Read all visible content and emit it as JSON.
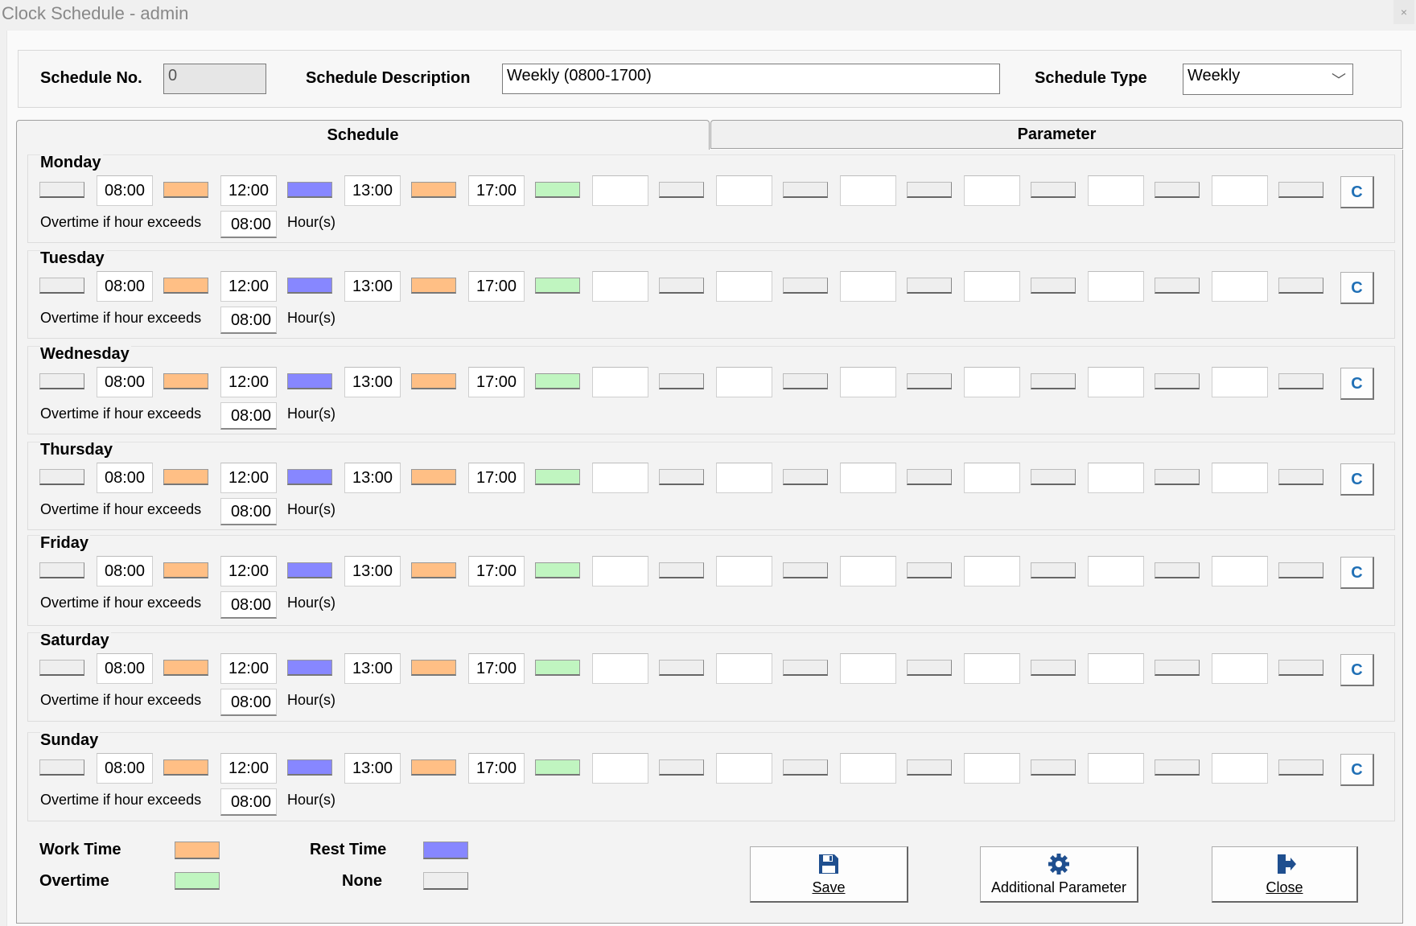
{
  "window": {
    "title": "Clock Schedule - admin",
    "close_glyph": "×"
  },
  "header": {
    "schedule_no_label": "Schedule No.",
    "schedule_no_value": "0",
    "description_label": "Schedule Description",
    "description_value": "Weekly (0800-1700)",
    "type_label": "Schedule Type",
    "type_value": "Weekly"
  },
  "tabs": [
    {
      "label": "Schedule"
    },
    {
      "label": "Parameter"
    }
  ],
  "colors": {
    "work": "#ffbf85",
    "rest": "#8787ff",
    "overtime": "#c0f5c0",
    "none": "#eeeeee",
    "accent": "#1f6fb5"
  },
  "days": [
    {
      "name": "Monday",
      "times": [
        "08:00",
        "12:00",
        "13:00",
        "17:00",
        "",
        "",
        "",
        "",
        "",
        ""
      ],
      "segments": [
        "none",
        "work",
        "rest",
        "work",
        "ot",
        "none",
        "none",
        "none",
        "none",
        "none",
        "none"
      ],
      "ot_label": "Overtime if hour exceeds",
      "ot_value": "08:00",
      "ot_unit": "Hour(s)",
      "clear_label": "C"
    },
    {
      "name": "Tuesday",
      "times": [
        "08:00",
        "12:00",
        "13:00",
        "17:00",
        "",
        "",
        "",
        "",
        "",
        ""
      ],
      "segments": [
        "none",
        "work",
        "rest",
        "work",
        "ot",
        "none",
        "none",
        "none",
        "none",
        "none",
        "none"
      ],
      "ot_label": "Overtime if hour exceeds",
      "ot_value": "08:00",
      "ot_unit": "Hour(s)",
      "clear_label": "C"
    },
    {
      "name": "Wednesday",
      "times": [
        "08:00",
        "12:00",
        "13:00",
        "17:00",
        "",
        "",
        "",
        "",
        "",
        ""
      ],
      "segments": [
        "none",
        "work",
        "rest",
        "work",
        "ot",
        "none",
        "none",
        "none",
        "none",
        "none",
        "none"
      ],
      "ot_label": "Overtime if hour exceeds",
      "ot_value": "08:00",
      "ot_unit": "Hour(s)",
      "clear_label": "C"
    },
    {
      "name": "Thursday",
      "times": [
        "08:00",
        "12:00",
        "13:00",
        "17:00",
        "",
        "",
        "",
        "",
        "",
        ""
      ],
      "segments": [
        "none",
        "work",
        "rest",
        "work",
        "ot",
        "none",
        "none",
        "none",
        "none",
        "none",
        "none"
      ],
      "ot_label": "Overtime if hour exceeds",
      "ot_value": "08:00",
      "ot_unit": "Hour(s)",
      "clear_label": "C"
    },
    {
      "name": "Friday",
      "times": [
        "08:00",
        "12:00",
        "13:00",
        "17:00",
        "",
        "",
        "",
        "",
        "",
        ""
      ],
      "segments": [
        "none",
        "work",
        "rest",
        "work",
        "ot",
        "none",
        "none",
        "none",
        "none",
        "none",
        "none"
      ],
      "ot_label": "Overtime if hour exceeds",
      "ot_value": "08:00",
      "ot_unit": "Hour(s)",
      "clear_label": "C"
    },
    {
      "name": "Saturday",
      "times": [
        "08:00",
        "12:00",
        "13:00",
        "17:00",
        "",
        "",
        "",
        "",
        "",
        ""
      ],
      "segments": [
        "none",
        "work",
        "rest",
        "work",
        "ot",
        "none",
        "none",
        "none",
        "none",
        "none",
        "none"
      ],
      "ot_label": "Overtime if hour exceeds",
      "ot_value": "08:00",
      "ot_unit": "Hour(s)",
      "clear_label": "C"
    },
    {
      "name": "Sunday",
      "times": [
        "08:00",
        "12:00",
        "13:00",
        "17:00",
        "",
        "",
        "",
        "",
        "",
        ""
      ],
      "segments": [
        "none",
        "work",
        "rest",
        "work",
        "ot",
        "none",
        "none",
        "none",
        "none",
        "none",
        "none"
      ],
      "ot_label": "Overtime if hour exceeds",
      "ot_value": "08:00",
      "ot_unit": "Hour(s)",
      "clear_label": "C"
    }
  ],
  "legend": {
    "work": "Work Time",
    "rest": "Rest Time",
    "overtime": "Overtime",
    "none": "None"
  },
  "buttons": {
    "save": {
      "label": "Save",
      "icon": "floppy-disk-icon"
    },
    "additional": {
      "label": "Additional Parameter",
      "icon": "gear-icon"
    },
    "close": {
      "label": "Close",
      "icon": "exit-door-icon"
    }
  }
}
